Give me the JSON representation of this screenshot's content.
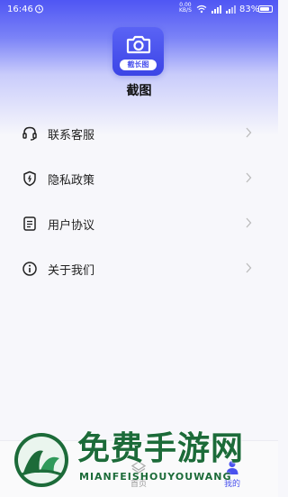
{
  "status_bar": {
    "time": "16:46",
    "net_speed_value": "0.00",
    "net_speed_unit": "KB/S",
    "battery": "83%",
    "battery_level": 0.83
  },
  "app": {
    "logo_badge": "截长图",
    "name": "截图"
  },
  "menu": {
    "items": [
      {
        "label": "联系客服",
        "icon": "headset-icon"
      },
      {
        "label": "隐私政策",
        "icon": "shield-icon"
      },
      {
        "label": "用户协议",
        "icon": "document-icon"
      },
      {
        "label": "关于我们",
        "icon": "info-icon"
      }
    ]
  },
  "bottom_nav": {
    "tabs": [
      {
        "label": "首页",
        "icon": "home-icon",
        "active": false
      },
      {
        "label": "我的",
        "icon": "user-icon",
        "active": true
      }
    ]
  },
  "watermark": {
    "title": "免费手游网",
    "subtitle": "MIANFEISHOUYOUWANG"
  },
  "colors": {
    "accent": "#4a52ee",
    "watermark": "#1c6b39"
  }
}
